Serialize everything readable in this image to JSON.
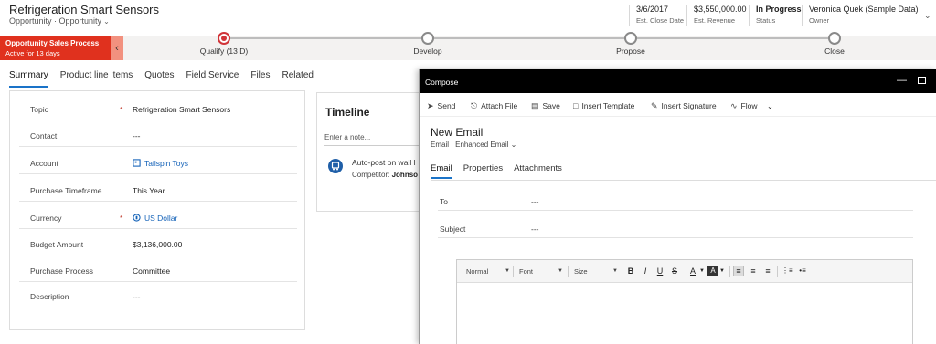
{
  "header": {
    "title": "Refrigeration Smart Sensors",
    "entity": "Opportunity",
    "form": "Opportunity",
    "fields": [
      {
        "value": "3/6/2017",
        "label": "Est. Close Date"
      },
      {
        "value": "$3,550,000.00",
        "label": "Est. Revenue"
      },
      {
        "value": "In Progress",
        "label": "Status"
      },
      {
        "value": "Veronica Quek (Sample Data)",
        "label": "Owner"
      }
    ]
  },
  "bpf": {
    "name": "Opportunity Sales Process",
    "active_for": "Active for 13 days",
    "stages": [
      {
        "label": "Qualify  (13 D)",
        "active": true
      },
      {
        "label": "Develop",
        "active": false
      },
      {
        "label": "Propose",
        "active": false
      },
      {
        "label": "Close",
        "active": false
      }
    ]
  },
  "tabs": [
    "Summary",
    "Product line items",
    "Quotes",
    "Field Service",
    "Files",
    "Related"
  ],
  "summary": {
    "fields": [
      {
        "label": "Topic",
        "required": true,
        "value": "Refrigeration Smart Sensors",
        "link": false,
        "icon": ""
      },
      {
        "label": "Contact",
        "required": false,
        "value": "---",
        "link": false,
        "icon": ""
      },
      {
        "label": "Account",
        "required": false,
        "value": "Tailspin Toys",
        "link": true,
        "icon": "account-icon"
      },
      {
        "label": "Purchase Timeframe",
        "required": false,
        "value": "This Year",
        "link": false,
        "icon": ""
      },
      {
        "label": "Currency",
        "required": true,
        "value": "US Dollar",
        "link": true,
        "icon": "currency-icon"
      },
      {
        "label": "Budget Amount",
        "required": false,
        "value": "$3,136,000.00",
        "link": false,
        "icon": ""
      },
      {
        "label": "Purchase Process",
        "required": false,
        "value": "Committee",
        "link": false,
        "icon": ""
      },
      {
        "label": "Description",
        "required": false,
        "value": "---",
        "link": false,
        "icon": ""
      }
    ]
  },
  "timeline": {
    "title": "Timeline",
    "note_placeholder": "Enter a note...",
    "post_text": "Auto-post on wall l",
    "competitor_label": "Competitor:",
    "competitor_value": "Johnso"
  },
  "compose": {
    "window_title": "Compose",
    "toolbar": {
      "send": "Send",
      "attach": "Attach File",
      "save": "Save",
      "template": "Insert Template",
      "signature": "Insert Signature",
      "flow": "Flow"
    },
    "title": "New Email",
    "entity": "Email",
    "form": "Enhanced Email",
    "tabs": [
      "Email",
      "Properties",
      "Attachments"
    ],
    "fields": [
      {
        "label": "To",
        "value": "---"
      },
      {
        "label": "Subject",
        "value": "---"
      }
    ],
    "editor": {
      "format": "Normal",
      "font": "Font",
      "size": "Size",
      "buttons": [
        "B",
        "I",
        "U",
        "S"
      ]
    }
  },
  "colors": {
    "accent": "#1a73c8",
    "bpf_flag": "#e0311e",
    "active_stage": "#d13438",
    "link": "#1462b8"
  }
}
